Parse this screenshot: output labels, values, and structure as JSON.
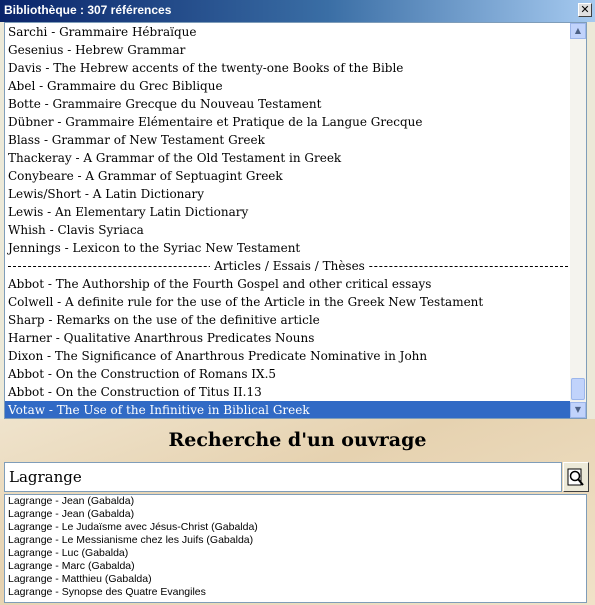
{
  "window": {
    "title": "Bibliothèque : 307 références",
    "close_label": "✕"
  },
  "list": {
    "items": [
      {
        "text": "Sarchi - Grammaire Hébraïque"
      },
      {
        "text": "Gesenius - Hebrew Grammar"
      },
      {
        "text": "Davis - The Hebrew accents of the twenty-one Books of the Bible"
      },
      {
        "text": "Abel - Grammaire du Grec Biblique"
      },
      {
        "text": "Botte - Grammaire Grecque du Nouveau Testament"
      },
      {
        "text": "Dübner - Grammaire Elémentaire et Pratique de la Langue Grecque"
      },
      {
        "text": "Blass - Grammar of New Testament Greek"
      },
      {
        "text": "Thackeray - A Grammar of  the Old Testament in Greek"
      },
      {
        "text": "Conybeare - A Grammar of Septuagint Greek"
      },
      {
        "text": "Lewis/Short - A Latin Dictionary"
      },
      {
        "text": "Lewis - An Elementary Latin Dictionary"
      },
      {
        "text": "Whish - Clavis Syriaca"
      },
      {
        "text": "Jennings - Lexicon to the Syriac New Testament"
      },
      {
        "text": "Articles / Essais / Thèses",
        "type": "separator"
      },
      {
        "text": "Abbot - The Authorship of the Fourth Gospel and other critical essays"
      },
      {
        "text": "Colwell - A definite rule for the use of the Article in the Greek  New Testament"
      },
      {
        "text": "Sharp - Remarks on the use of the definitive article"
      },
      {
        "text": "Harner - Qualitative Anarthrous Predicates Nouns"
      },
      {
        "text": "Dixon - The Significance of Anarthrous Predicate Nominative in John"
      },
      {
        "text": "Abbot - On the Construction of Romans IX.5"
      },
      {
        "text": "Abbot - On the Construction of Titus II.13"
      },
      {
        "text": "Votaw - The Use of the Infinitive in Biblical Greek",
        "selected": true
      }
    ],
    "scroll_up_label": "▲",
    "scroll_down_label": "▼"
  },
  "search": {
    "heading": "Recherche d'un ouvrage",
    "value": "Lagrange",
    "button_icon": "search-icon",
    "results": [
      "Lagrange - Jean (Gabalda)",
      "Lagrange - Jean (Gabalda)",
      "Lagrange - Le Judaïsme avec Jésus-Christ (Gabalda)",
      "Lagrange - Le Messianisme chez les Juifs (Gabalda)",
      "Lagrange - Luc (Gabalda)",
      "Lagrange - Marc (Gabalda)",
      "Lagrange - Matthieu (Gabalda)",
      "Lagrange - Synopse des Quatre Evangiles"
    ]
  },
  "colors": {
    "selection": "#316ac5",
    "titlebar": "#0a246a",
    "parchment": "#e6d2b0"
  }
}
